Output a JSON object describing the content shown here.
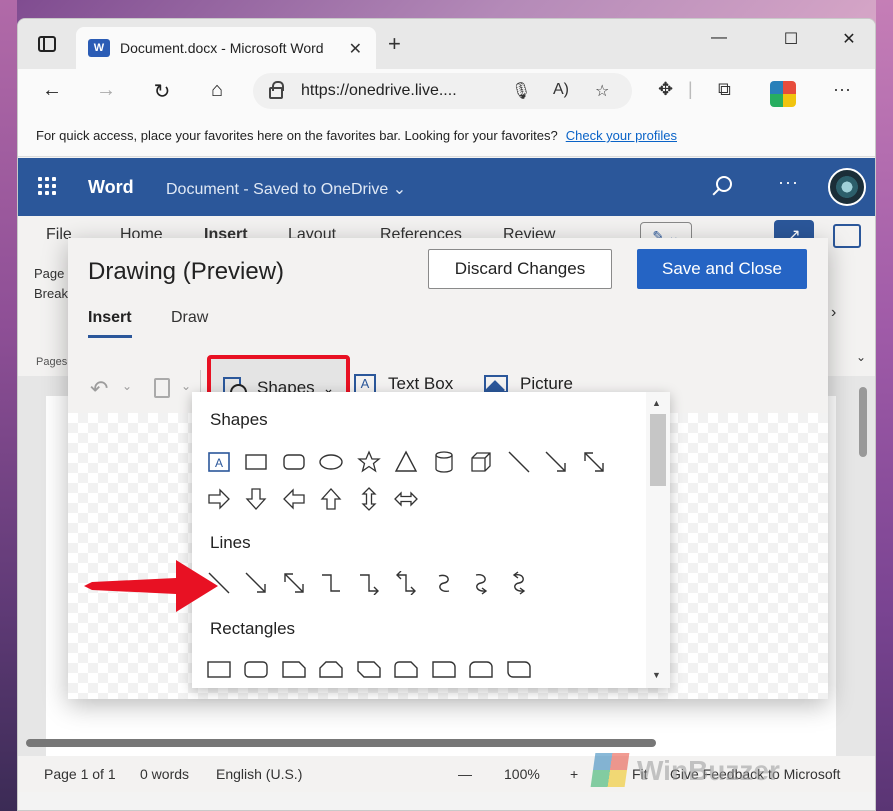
{
  "browser": {
    "tab_title": "Document.docx - Microsoft Word",
    "tab_close": "✕",
    "new_tab": "+",
    "window_controls": {
      "minimize": "—",
      "maximize": "☐",
      "close": "✕"
    },
    "url": "https://onedrive.live....",
    "favorites_message": "For quick access, place your favorites here on the favorites bar. Looking for your favorites?",
    "favorites_link": "Check your profiles"
  },
  "word": {
    "brand": "Word",
    "document_status": "Document  -  Saved to OneDrive ⌄",
    "more": "···",
    "ribbon_tabs": [
      "File",
      "Home",
      "Insert",
      "Layout",
      "References",
      "Review"
    ],
    "ribbon_page_break": "Page\nBreak",
    "ribbon_group": "Pages",
    "status": {
      "page": "Page 1 of 1",
      "words": "0 words",
      "language": "English (U.S.)",
      "zoom": "100%",
      "fit": "Fit",
      "feedback": "Give Feedback to Microsoft"
    },
    "watermark": "WinBuzzer"
  },
  "dialog": {
    "title": "Drawing (Preview)",
    "discard_label": "Discard Changes",
    "save_label": "Save and Close",
    "tabs": [
      "Insert",
      "Draw"
    ],
    "toolbar": {
      "shapes_label": "Shapes",
      "textbox_label": "Text Box",
      "textbox_glyph": "A",
      "picture_label": "Picture"
    }
  },
  "shapes_menu": {
    "sections": [
      "Shapes",
      "Lines",
      "Rectangles"
    ],
    "basic_shapes": [
      "text-box",
      "rectangle",
      "rounded-rectangle",
      "oval",
      "star",
      "triangle",
      "cylinder",
      "cube",
      "line",
      "arrow-line",
      "double-arrow-line"
    ],
    "block_arrows": [
      "arrow-right",
      "arrow-down",
      "arrow-left",
      "arrow-up",
      "arrow-up-down",
      "arrow-left-right"
    ],
    "lines": [
      "line",
      "arrow",
      "double-arrow",
      "elbow-connector",
      "elbow-arrow",
      "elbow-double-arrow",
      "curved-connector",
      "curved-arrow",
      "curved-double-arrow"
    ],
    "rectangles": [
      "rectangle",
      "rounded-rectangle",
      "snip-single-corner",
      "snip-same-side",
      "snip-diagonal",
      "snip-round-single",
      "round-single-corner",
      "round-same-side",
      "round-diagonal"
    ]
  },
  "colors": {
    "word_blue": "#2b579a",
    "save_blue": "#2564c4",
    "highlight_red": "#e81123"
  }
}
